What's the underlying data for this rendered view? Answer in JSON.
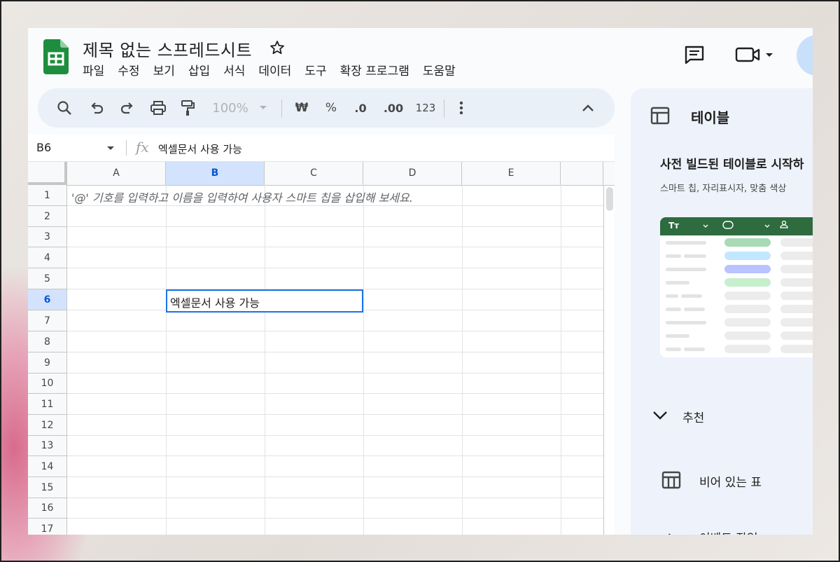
{
  "app": {
    "title": "제목 없는 스프레드시트",
    "menu": [
      "파일",
      "수정",
      "보기",
      "삽입",
      "서식",
      "데이터",
      "도구",
      "확장 프로그램",
      "도움말"
    ]
  },
  "toolbar": {
    "zoom": "100%",
    "currency": "₩",
    "percent": "%",
    "decrease_decimal": ".0",
    "increase_decimal": ".00",
    "number_format": "123"
  },
  "formula_bar": {
    "cell_ref": "B6",
    "fx": "fx",
    "content": "엑셀문서 사용 가능"
  },
  "grid": {
    "columns": [
      "A",
      "B",
      "C",
      "D",
      "E"
    ],
    "rows": [
      "1",
      "2",
      "3",
      "4",
      "5",
      "6",
      "7",
      "8",
      "9",
      "10",
      "11",
      "12",
      "13",
      "14",
      "15",
      "16",
      "17"
    ],
    "selected_column": "B",
    "selected_row": "6",
    "a1_hint": "'@' 기호를 입력하고 이름을 입력하여 사용자 스마트 칩을 삽입해 보세요.",
    "b6_value": "엑셀문서 사용 가능"
  },
  "side_panel": {
    "title": "테이블",
    "heading": "사전 빌드된 테이블로 시작하",
    "description": "스마트 칩, 자리표시자, 맞춤 색상",
    "preview_header_label": "Tт",
    "section": "추천",
    "item_empty": "비어 있는 표",
    "item_next": "이벤트 작업"
  },
  "colors": {
    "accent": "#1a73e8",
    "selected_header": "#d3e3fd",
    "toolbar_bg": "#eaf0f8",
    "sheets_green": "#1e8e3e"
  }
}
